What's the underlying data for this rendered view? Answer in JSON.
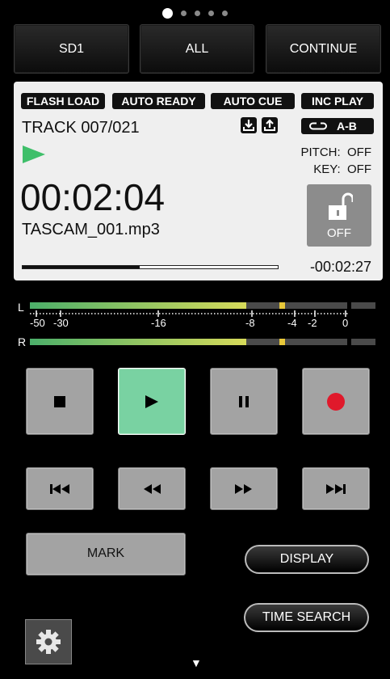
{
  "pager": {
    "pages": 5,
    "active": 1
  },
  "top_buttons": {
    "media": "SD1",
    "play_area": "ALL",
    "play_mode": "CONTINUE"
  },
  "badges": {
    "flash_load": "FLASH LOAD",
    "auto_ready": "AUTO READY",
    "auto_cue": "AUTO CUE",
    "inc_play": "INC PLAY"
  },
  "track_label": "TRACK 007/021",
  "ab_label": "A-B",
  "pitch": {
    "label": "PITCH:",
    "value": "OFF"
  },
  "key": {
    "label": "KEY:",
    "value": "OFF"
  },
  "elapsed": "00:02:04",
  "filename": "TASCAM_001.mp3",
  "lock_label": "OFF",
  "remaining": "-00:02:27",
  "progress_fraction": 0.46,
  "meters": {
    "left_label": "L",
    "right_label": "R",
    "scale": [
      "-50",
      "-30",
      "-16",
      "-8",
      "-4",
      "-2",
      "0"
    ],
    "level_colors": [
      "#4caf6a",
      "#d6da5a"
    ]
  },
  "transport": {
    "mark_label": "MARK"
  },
  "display_button": "DISPLAY",
  "time_search_button": "TIME SEARCH",
  "colors": {
    "play_active": "#79d2a2",
    "record": "#e0192b",
    "play_indicator": "#3fbf6a"
  }
}
